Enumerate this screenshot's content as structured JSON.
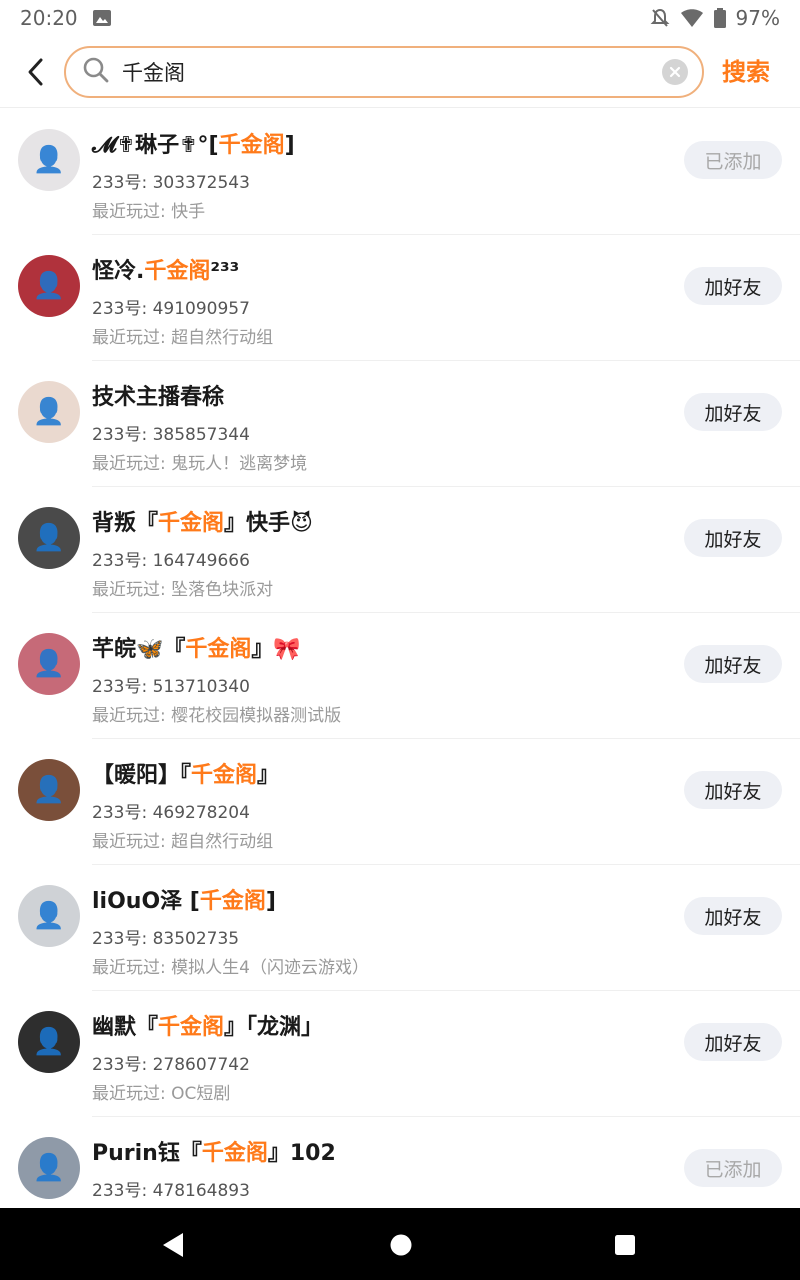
{
  "status_bar": {
    "time": "20:20",
    "battery": "97%"
  },
  "search": {
    "query": "千金阁",
    "submit_label": "搜索"
  },
  "colors": {
    "accent": "#ff7a1a",
    "search_border": "#f0b07c",
    "button_bg": "#eef0f5"
  },
  "results": [
    {
      "name_pre": "𝓜✟琳子✟°[",
      "name_hl": "千金阁",
      "name_post": "]",
      "uid": "233号: 303372543",
      "played": "最近玩过: 快手",
      "button": "已添加",
      "button_state": "added",
      "avatar_color": "#e6e4e6"
    },
    {
      "name_pre": "怪冷.",
      "name_hl": "千金阁",
      "name_post": "²³³",
      "uid": "233号: 491090957",
      "played": "最近玩过: 超自然行动组",
      "button": "加好友",
      "button_state": "add",
      "avatar_color": "#b0323c"
    },
    {
      "name_pre": "技术主播春稌",
      "name_hl": "",
      "name_post": "",
      "uid": "233号: 385857344",
      "played": "最近玩过: 鬼玩人！逃离梦境",
      "button": "加好友",
      "button_state": "add",
      "avatar_color": "#ead9cf"
    },
    {
      "name_pre": "背叛『",
      "name_hl": "千金阁",
      "name_post": "』快手😈",
      "uid": "233号: 164749666",
      "played": "最近玩过: 坠落色块派对",
      "button": "加好友",
      "button_state": "add",
      "avatar_color": "#4a4a4a"
    },
    {
      "name_pre": "芊皖🦋『",
      "name_hl": "千金阁",
      "name_post": "』🎀",
      "uid": "233号: 513710340",
      "played": "最近玩过: 樱花校园模拟器测试版",
      "button": "加好友",
      "button_state": "add",
      "avatar_color": "#c66a78"
    },
    {
      "name_pre": "【暖阳】『",
      "name_hl": "千金阁",
      "name_post": "』",
      "uid": "233号: 469278204",
      "played": "最近玩过: 超自然行动组",
      "button": "加好友",
      "button_state": "add",
      "avatar_color": "#7a4f3a"
    },
    {
      "name_pre": "liOuO泽 [",
      "name_hl": "千金阁",
      "name_post": "]",
      "uid": "233号: 83502735",
      "played": "最近玩过: 模拟人生4（闪迹云游戏）",
      "button": "加好友",
      "button_state": "add",
      "avatar_color": "#cfd2d6"
    },
    {
      "name_pre": "幽默『",
      "name_hl": "千金阁",
      "name_post": "』「龙渊」",
      "uid": "233号: 278607742",
      "played": "最近玩过: OC短剧",
      "button": "加好友",
      "button_state": "add",
      "avatar_color": "#2e2e2e"
    },
    {
      "name_pre": "Purin钰『",
      "name_hl": "千金阁",
      "name_post": "』102",
      "uid": "233号: 478164893",
      "played": "",
      "button": "已添加",
      "button_state": "added",
      "avatar_color": "#8f9aa8"
    }
  ]
}
